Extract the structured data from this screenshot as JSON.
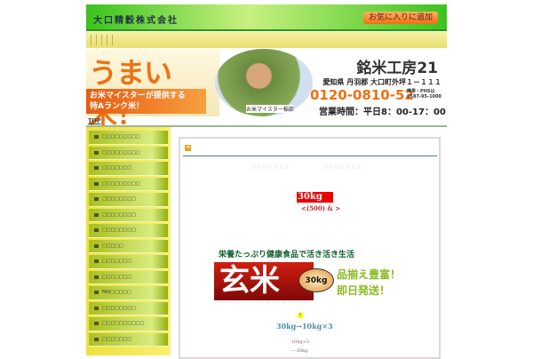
{
  "header": {
    "company": "大口精穀株式会社",
    "favorite_button": "お気に入りに追加"
  },
  "banner": {
    "headline": "うまい米！",
    "subline1": "お米マイスターが提供する",
    "subline2": "特Aランク米！",
    "caption": "お米マイスター稲部",
    "brand": "銘米工房21",
    "address": "愛知県 丹羽郡 大口町外坪１－１１１",
    "phone": "0120-0810-52",
    "mobile1": "携帯・PHSは",
    "mobile2": "0587-95-1000",
    "hours": "営業時間：平日8：00-17：00"
  },
  "breadcrumb": {
    "top": "TOP"
  },
  "sidebar": {
    "items": [
      "□□□□□□□□□",
      "□□□□□□□□□",
      "□□□□□□□",
      "□□□□□□□□□",
      "□□□□□□□□",
      "□□□□□□□□",
      "□□□□□□□□",
      "□□□□□",
      "□□□□□□□",
      "□□□□□□□",
      "FAX□□□□□",
      "□□□□□□□□",
      "□□□□□□□□□□",
      "□□□□□□□"
    ]
  },
  "main": {
    "stars_left": "☆☆☆☆☆☆☆",
    "stars_right": "☆☆☆☆☆☆☆",
    "product_weight": "30kg",
    "product_sub": "<(500) & >",
    "tagline": "栄養たっぷり健康食品で活き活き生活",
    "genmai": "玄米",
    "badge": "30kg",
    "promo1": "品揃え豊富！",
    "promo2": "即日発送！",
    "excl": "!",
    "combo": "30kg→10kg×3",
    "line1": "10kg×3",
    "line2": "----30kg"
  }
}
